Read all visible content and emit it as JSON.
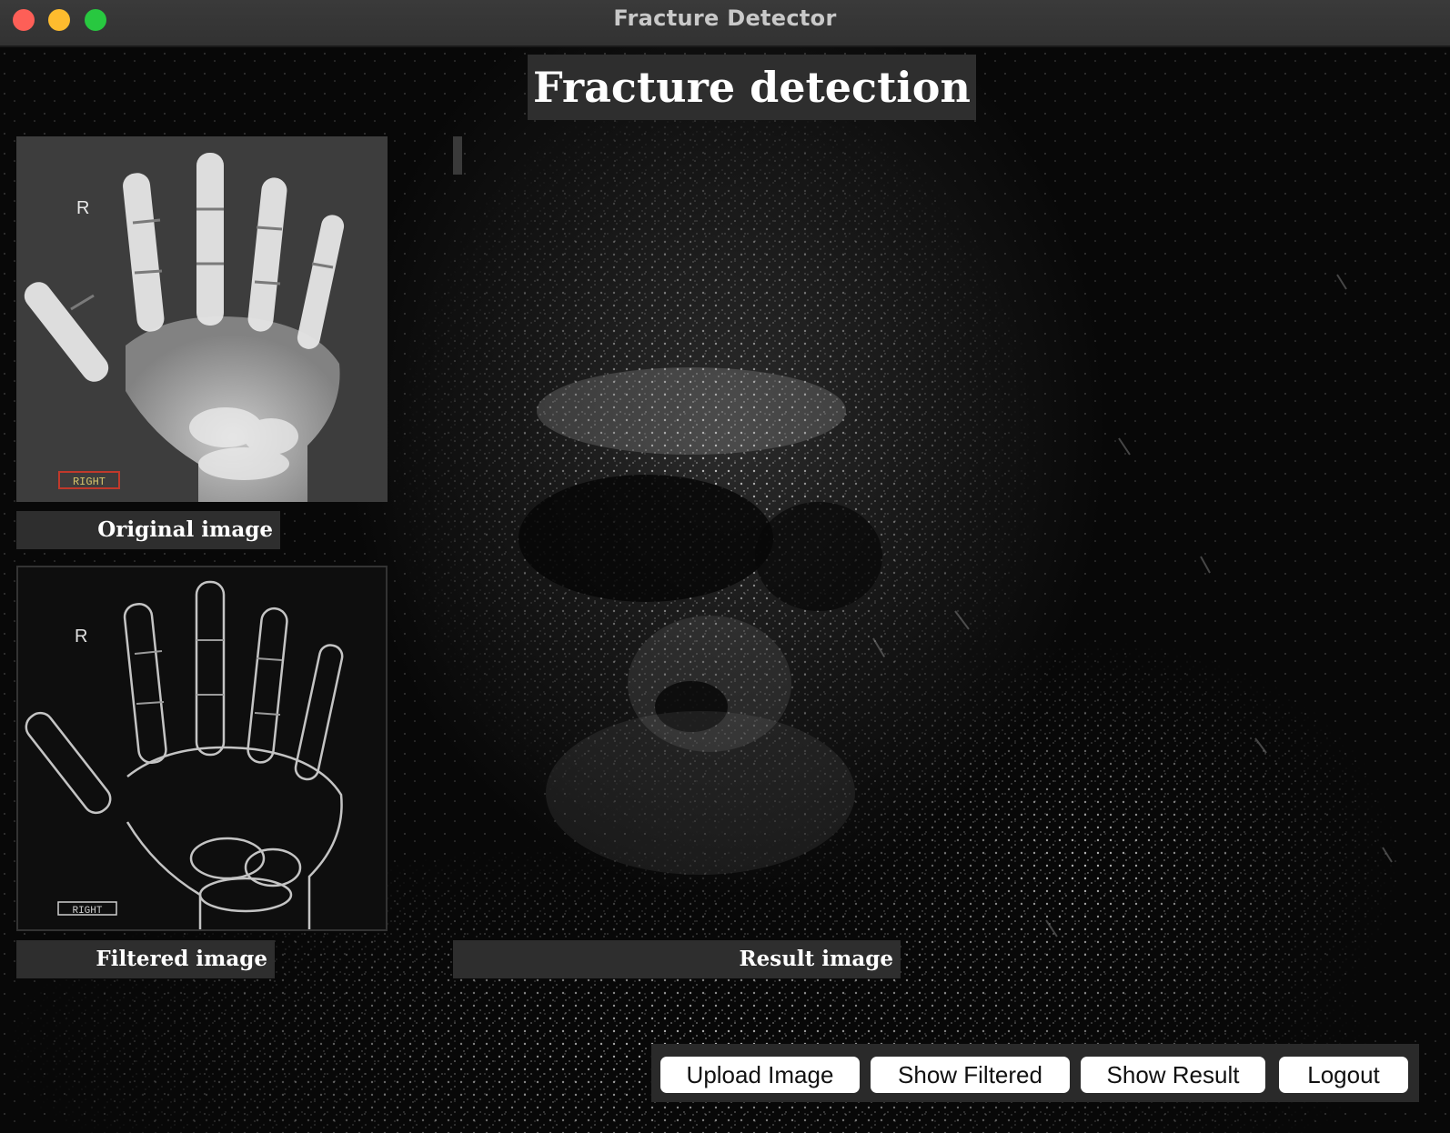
{
  "window": {
    "title": "Fracture Detector"
  },
  "main": {
    "heading": "Fracture detection",
    "original_caption": "Original image",
    "filtered_caption": "Filtered image",
    "result_caption": "Result image"
  },
  "xray": {
    "side_marker": "R",
    "label": "RIGHT"
  },
  "buttons": {
    "upload": "Upload Image",
    "show_filtered": "Show Filtered",
    "show_result": "Show Result",
    "logout": "Logout"
  },
  "colors": {
    "close": "#fe5f57",
    "minimize": "#febc2e",
    "zoom": "#28c840",
    "label_red": "#c0392b",
    "label_yellow": "#d4c36a"
  }
}
